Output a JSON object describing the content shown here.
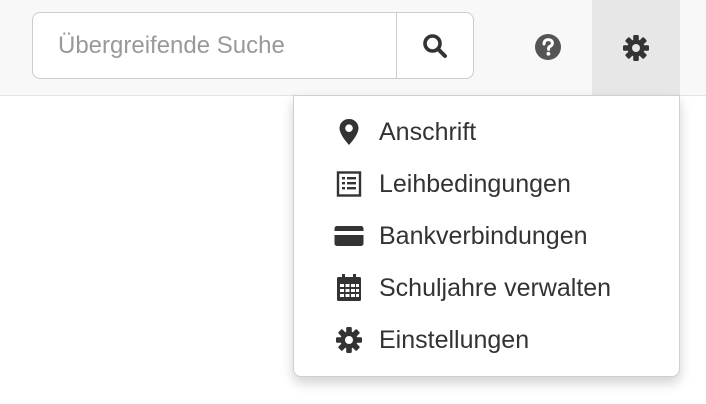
{
  "search": {
    "placeholder": "Übergreifende Suche",
    "value": "",
    "button_icon": "search-icon"
  },
  "header": {
    "help_icon": "question-circle-icon",
    "settings_icon": "gear-icon"
  },
  "settings_menu": {
    "items": [
      {
        "label": "Anschrift",
        "icon": "map-marker-icon"
      },
      {
        "label": "Leihbedingungen",
        "icon": "list-document-icon"
      },
      {
        "label": "Bankverbindungen",
        "icon": "credit-card-icon"
      },
      {
        "label": "Schuljahre verwalten",
        "icon": "calendar-icon"
      },
      {
        "label": "Einstellungen",
        "icon": "gear-icon"
      }
    ]
  },
  "colors": {
    "icon": "#333333",
    "topbar_bg": "#f8f8f8",
    "settings_active_bg": "#e7e7e7"
  }
}
